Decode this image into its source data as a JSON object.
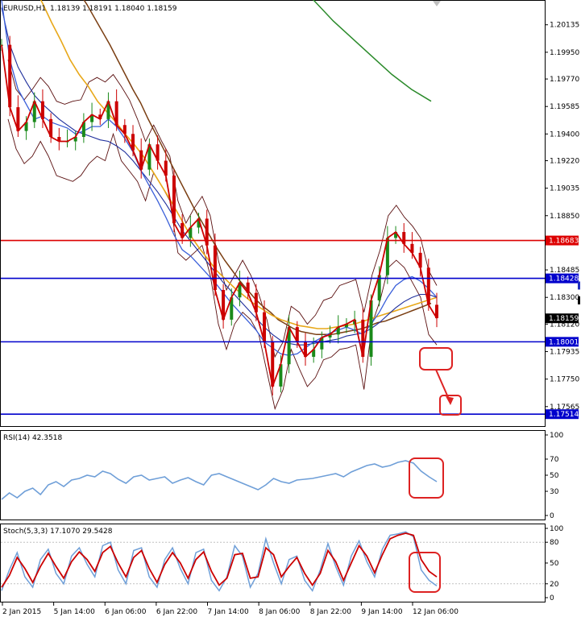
{
  "window": {
    "symbol_label": "EURUSD,H1",
    "ohlc_label": "1.18139 1.18191 1.18040 1.18159"
  },
  "colors": {
    "price": "#cc0000",
    "candle_up": "#1a8a1a",
    "candle_down": "#cc0000",
    "bollinger": "#5a0f0f",
    "ma_fast": "#3a5fd9",
    "ma_slow_blue": "#1f2f9c",
    "ma_orange": "#e8a81a",
    "ma_brown": "#7a3e12",
    "ma_green": "#2a8a2a",
    "hline_red": "#dd0000",
    "hline_blue": "#0000cc",
    "rsi_line": "#6f9fd8",
    "stoch_main": "#6f9fd8",
    "stoch_signal": "#cc0000",
    "annotation": "#dd2222"
  },
  "price_pane": {
    "price_ticks": [
      "1.20135",
      "1.19950",
      "1.19770",
      "1.19585",
      "1.19400",
      "1.19220",
      "1.19035",
      "1.18850",
      "1.18485",
      "1.18300",
      "1.18120",
      "1.17935",
      "1.17750",
      "1.17565"
    ],
    "hline_labels": {
      "red": "1.18683",
      "blue_top": "1.18428",
      "current": "1.18159",
      "blue_mid": "1.18001",
      "blue_low": "1.17514"
    }
  },
  "rsi_pane": {
    "label": "RSI(14) 42.3518",
    "ticks": [
      "100",
      "70",
      "50",
      "30",
      "0"
    ]
  },
  "stoch_pane": {
    "label": "Stoch(5,3,3) 17.1070 29.5428",
    "ticks": [
      "100",
      "80",
      "50",
      "20",
      "0"
    ]
  },
  "time_axis": {
    "labels": [
      "2 Jan 2015",
      "5 Jan 14:00",
      "6 Jan 06:00",
      "6 Jan 22:00",
      "7 Jan 14:00",
      "8 Jan 06:00",
      "8 Jan 22:00",
      "9 Jan 14:00",
      "12 Jan 06:00"
    ]
  },
  "chart_data": [
    {
      "type": "line",
      "title": "EURUSD,H1",
      "ohlc": {
        "open": 1.18139,
        "high": 1.18191,
        "low": 1.1804,
        "close": 1.18159
      },
      "x": [
        "2 Jan 2015",
        "5 Jan 14:00",
        "6 Jan 06:00",
        "6 Jan 22:00",
        "7 Jan 14:00",
        "8 Jan 06:00",
        "8 Jan 22:00",
        "9 Jan 14:00",
        "12 Jan 06:00"
      ],
      "ylim": [
        1.1745,
        1.2028
      ],
      "series": [
        {
          "values": [
            1.2,
            1.1958,
            1.1942,
            1.1948,
            1.1962,
            1.195,
            1.1938,
            1.1935,
            1.1935,
            1.1938,
            1.1948,
            1.1953,
            1.195,
            1.1962,
            1.1946,
            1.194,
            1.1929,
            1.1916,
            1.1933,
            1.1922,
            1.1912,
            1.188,
            1.187,
            1.1877,
            1.1883,
            1.1865,
            1.1835,
            1.1815,
            1.183,
            1.184,
            1.1833,
            1.182,
            1.18,
            1.177,
            1.1785,
            1.181,
            1.18,
            1.179,
            1.1795,
            1.1803,
            1.1805,
            1.181,
            1.1812,
            1.1815,
            1.179,
            1.1828,
            1.1845,
            1.187,
            1.1874,
            1.1866,
            1.186,
            1.185,
            1.1825,
            1.1816
          ]
        },
        {
          "values": [
            1.203,
            1.199,
            1.197,
            1.196,
            1.195,
            1.1952,
            1.1948,
            1.1946,
            1.1944,
            1.194,
            1.1942,
            1.1945,
            1.1945,
            1.195,
            1.1945,
            1.1937,
            1.1928,
            1.1915,
            1.1905,
            1.1895,
            1.1884,
            1.1872,
            1.1862,
            1.1858,
            1.1852,
            1.1846,
            1.184,
            1.1833,
            1.1826,
            1.182,
            1.1814,
            1.1808,
            1.18,
            1.1796,
            1.1792,
            1.1791,
            1.1792,
            1.1796,
            1.18,
            1.1803,
            1.1806,
            1.1808,
            1.181,
            1.1808,
            1.1805,
            1.1812,
            1.182,
            1.183,
            1.1838,
            1.1842,
            1.1844,
            1.1841,
            1.1836,
            1.183
          ]
        },
        {
          "values": [
            1.2025,
            1.2,
            1.1985,
            1.1975,
            1.1966,
            1.196,
            1.1955,
            1.195,
            1.1946,
            1.1942,
            1.194,
            1.1938,
            1.1936,
            1.1935,
            1.1932,
            1.1928,
            1.1922,
            1.1915,
            1.1908,
            1.1901,
            1.1893,
            1.1884,
            1.1875,
            1.1868,
            1.1861,
            1.1854,
            1.1847,
            1.184,
            1.1834,
            1.1828,
            1.1822,
            1.1816,
            1.181,
            1.1805,
            1.1801,
            1.1799,
            1.1798,
            1.1798,
            1.1799,
            1.18,
            1.1801,
            1.1802,
            1.1804,
            1.1805,
            1.1806,
            1.1809,
            1.1813,
            1.1818,
            1.1823,
            1.1827,
            1.183,
            1.1832,
            1.1832,
            1.183
          ]
        },
        {
          "values": [
            1.205,
            1.204,
            1.2028,
            1.2015,
            1.2003,
            1.199,
            1.198,
            1.1972,
            1.1962,
            1.1955,
            1.1948,
            1.194,
            1.1933,
            1.1925,
            1.1915,
            1.1905,
            1.1895,
            1.1884,
            1.1873,
            1.1864,
            1.1856,
            1.1848,
            1.1842,
            1.1836,
            1.1831,
            1.1826,
            1.1822,
            1.1818,
            1.1815,
            1.1813,
            1.1811,
            1.181,
            1.1809,
            1.1809,
            1.181,
            1.1811,
            1.1812,
            1.1814,
            1.1816,
            1.1818,
            1.182,
            1.1822,
            1.1824,
            1.1826,
            1.1828,
            1.183
          ]
        },
        {
          "values": [
            1.206,
            1.2052,
            1.2044,
            1.2035,
            1.2027,
            1.2018,
            1.2009,
            1.2,
            1.199,
            1.198,
            1.197,
            1.1961,
            1.195,
            1.194,
            1.193,
            1.192,
            1.191,
            1.19,
            1.189,
            1.1881,
            1.1872,
            1.1863,
            1.1855,
            1.1848,
            1.1841,
            1.1835,
            1.1829,
            1.1824,
            1.182,
            1.1815,
            1.1812,
            1.1809,
            1.1807,
            1.1806,
            1.1805,
            1.1805,
            1.1805,
            1.1806,
            1.1807,
            1.1808,
            1.1809,
            1.1811,
            1.1813,
            1.1814,
            1.1816,
            1.1818,
            1.182,
            1.1822,
            1.1824,
            1.1826
          ]
        },
        {
          "values": [
            1.2045,
            1.203,
            1.2016,
            1.2004,
            1.1992,
            1.198,
            1.197,
            1.1962
          ]
        },
        {
          "values": [
            1.199,
            1.197,
            1.1963,
            1.197,
            1.1978,
            1.1972,
            1.1962,
            1.196,
            1.1962,
            1.1963,
            1.1975,
            1.1978,
            1.1975,
            1.198,
            1.1972,
            1.1963,
            1.195,
            1.1935,
            1.1946,
            1.1935,
            1.1925,
            1.1895,
            1.188,
            1.189,
            1.1898,
            1.1885,
            1.1855,
            1.1835,
            1.1845,
            1.1855,
            1.1845,
            1.1832,
            1.1815,
            1.179,
            1.18,
            1.1824,
            1.182,
            1.1812,
            1.1818,
            1.1828,
            1.183,
            1.1838,
            1.184,
            1.1842,
            1.182,
            1.1845,
            1.1862,
            1.1885,
            1.1892,
            1.1884,
            1.1878,
            1.187,
            1.1848,
            1.1838
          ]
        },
        {
          "values": [
            1.195,
            1.193,
            1.192,
            1.1925,
            1.1935,
            1.1925,
            1.1912,
            1.191,
            1.1908,
            1.1912,
            1.192,
            1.1925,
            1.1922,
            1.194,
            1.1922,
            1.1915,
            1.1908,
            1.1895,
            1.1914,
            1.1905,
            1.1895,
            1.186,
            1.1855,
            1.186,
            1.1865,
            1.1845,
            1.1812,
            1.1795,
            1.1812,
            1.182,
            1.1815,
            1.1805,
            1.178,
            1.1755,
            1.1768,
            1.1795,
            1.1782,
            1.177,
            1.1776,
            1.1788,
            1.179,
            1.1795,
            1.1796,
            1.1798,
            1.1768,
            1.1812,
            1.1828,
            1.185,
            1.1855,
            1.185,
            1.184,
            1.183,
            1.1805,
            1.1798
          ]
        }
      ],
      "hlines": [
        1.18683,
        1.18428,
        1.18001,
        1.17514
      ]
    },
    {
      "type": "line",
      "title": "RSI(14) 42.3518",
      "ylim": [
        0,
        100
      ],
      "ticks": [
        100,
        70,
        50,
        30,
        0
      ],
      "series": [
        {
          "values": [
            20,
            28,
            22,
            30,
            34,
            26,
            38,
            42,
            36,
            44,
            46,
            50,
            48,
            55,
            52,
            45,
            40,
            48,
            50,
            44,
            46,
            48,
            40,
            44,
            47,
            42,
            38,
            50,
            52,
            48,
            44,
            40,
            36,
            32,
            38,
            46,
            42,
            40,
            44,
            45,
            46,
            48,
            50,
            52,
            48,
            54,
            58,
            62,
            64,
            60,
            62,
            66,
            68,
            65,
            55,
            48,
            42
          ]
        }
      ]
    },
    {
      "type": "line",
      "title": "Stoch(5,3,3) 17.1070 29.5428",
      "ylim": [
        0,
        100
      ],
      "ticks": [
        100,
        80,
        50,
        20,
        0
      ],
      "series": [
        {
          "values": [
            10,
            40,
            65,
            30,
            15,
            55,
            70,
            35,
            20,
            60,
            72,
            48,
            30,
            75,
            80,
            40,
            20,
            68,
            72,
            30,
            15,
            55,
            72,
            42,
            20,
            65,
            70,
            25,
            10,
            30,
            75,
            60,
            15,
            35,
            85,
            50,
            20,
            55,
            60,
            25,
            10,
            40,
            78,
            45,
            18,
            60,
            82,
            52,
            30,
            70,
            90,
            92,
            95,
            88,
            40,
            25,
            17
          ]
        },
        {
          "values": [
            15,
            32,
            58,
            42,
            22,
            45,
            64,
            45,
            28,
            52,
            66,
            55,
            38,
            65,
            74,
            50,
            30,
            58,
            68,
            42,
            22,
            48,
            65,
            50,
            28,
            55,
            66,
            38,
            18,
            28,
            62,
            64,
            28,
            30,
            72,
            62,
            30,
            45,
            58,
            35,
            18,
            35,
            68,
            52,
            25,
            50,
            75,
            60,
            36,
            62,
            85,
            90,
            93,
            90,
            55,
            38,
            30
          ]
        }
      ]
    }
  ]
}
